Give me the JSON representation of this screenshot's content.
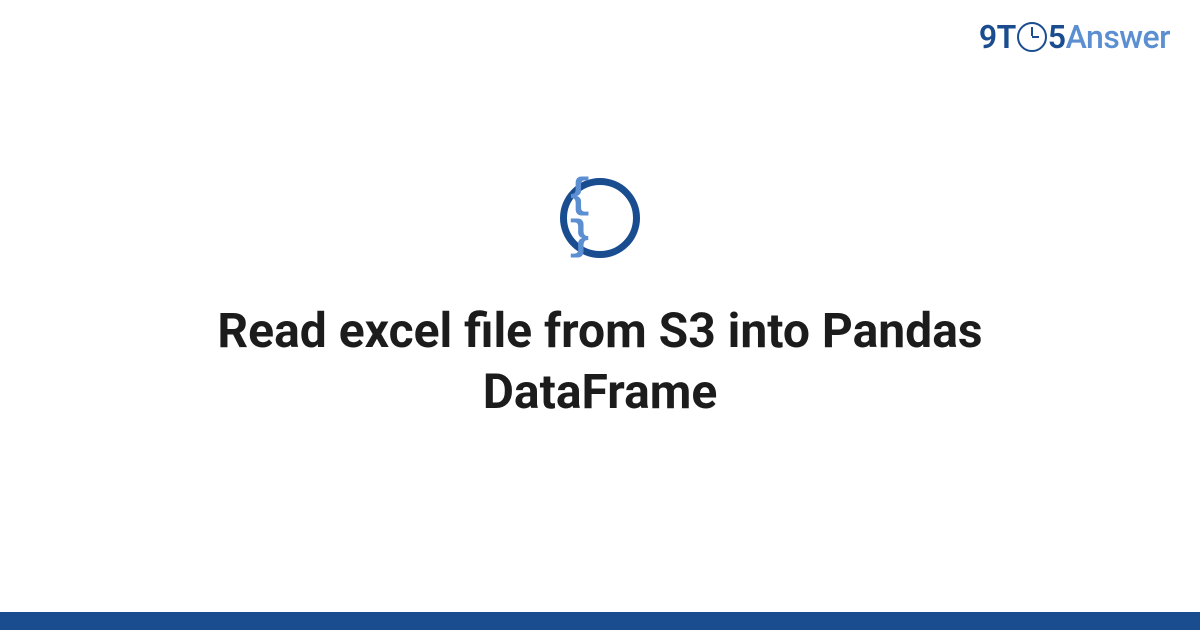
{
  "logo": {
    "part1": "9T",
    "part2": "5",
    "part3": "Answer"
  },
  "icon": {
    "name": "code-braces-icon",
    "glyph": "{ }"
  },
  "title": "Read excel file from S3 into Pandas DataFrame"
}
